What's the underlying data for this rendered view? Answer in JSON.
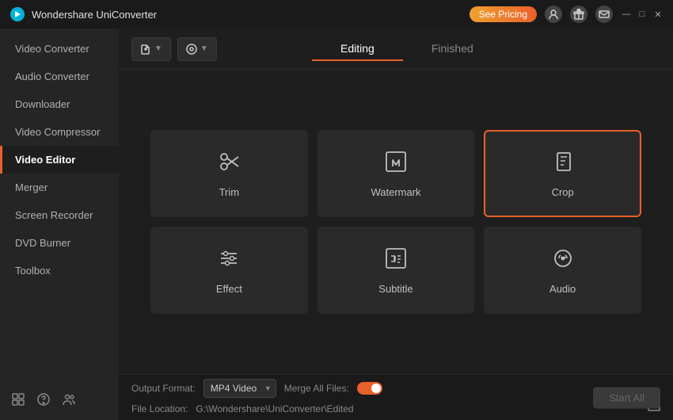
{
  "titlebar": {
    "app_name": "Wondershare UniConverter",
    "see_pricing": "See Pricing"
  },
  "sidebar": {
    "items": [
      {
        "id": "video-converter",
        "label": "Video Converter",
        "active": false
      },
      {
        "id": "audio-converter",
        "label": "Audio Converter",
        "active": false
      },
      {
        "id": "downloader",
        "label": "Downloader",
        "active": false
      },
      {
        "id": "video-compressor",
        "label": "Video Compressor",
        "active": false
      },
      {
        "id": "video-editor",
        "label": "Video Editor",
        "active": true
      },
      {
        "id": "merger",
        "label": "Merger",
        "active": false
      },
      {
        "id": "screen-recorder",
        "label": "Screen Recorder",
        "active": false
      },
      {
        "id": "dvd-burner",
        "label": "DVD Burner",
        "active": false
      },
      {
        "id": "toolbox",
        "label": "Toolbox",
        "active": false
      }
    ]
  },
  "tabs": {
    "editing": "Editing",
    "finished": "Finished"
  },
  "tools": [
    {
      "id": "trim",
      "label": "Trim",
      "icon": "scissors"
    },
    {
      "id": "watermark",
      "label": "Watermark",
      "icon": "watermark"
    },
    {
      "id": "crop",
      "label": "Crop",
      "icon": "crop",
      "selected": true
    },
    {
      "id": "effect",
      "label": "Effect",
      "icon": "effect"
    },
    {
      "id": "subtitle",
      "label": "Subtitle",
      "icon": "subtitle"
    },
    {
      "id": "audio",
      "label": "Audio",
      "icon": "audio"
    }
  ],
  "bottombar": {
    "output_format_label": "Output Format:",
    "output_format_value": "MP4 Video",
    "merge_all_label": "Merge All Files:",
    "file_location_label": "File Location:",
    "file_path": "G:\\Wondershare\\UniConverter\\Edited",
    "start_all": "Start All"
  }
}
